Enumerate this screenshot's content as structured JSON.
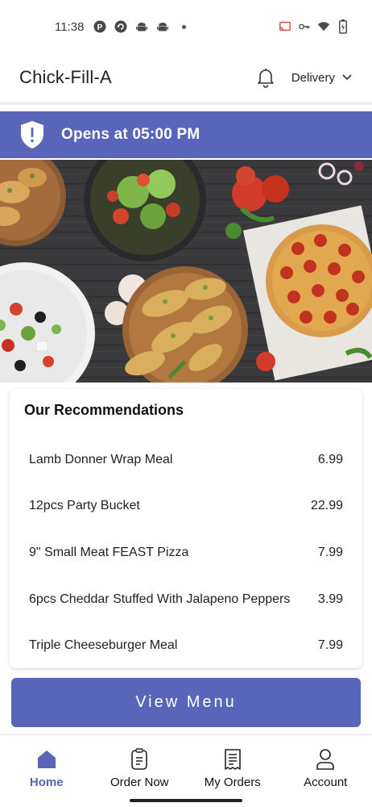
{
  "status_bar": {
    "time": "11:38",
    "left_icons": [
      "p-circle-icon",
      "refresh-circle-icon",
      "android-icon",
      "android-icon",
      "dot-icon"
    ],
    "right_icons": [
      "cast-icon",
      "key-icon",
      "wifi-icon",
      "battery-icon"
    ]
  },
  "header": {
    "title": "Chick-Fill-A",
    "bell_icon": "bell-icon",
    "mode_label": "Delivery"
  },
  "banner": {
    "icon": "shield-alert-icon",
    "text": "Opens at 05:00 PM",
    "color": "#5865b8"
  },
  "hero": {
    "icon": "food-hero-image"
  },
  "recommendations": {
    "title": "Our Recommendations",
    "items": [
      {
        "name": "Lamb Donner Wrap Meal",
        "price": "6.99"
      },
      {
        "name": "12pcs Party Bucket",
        "price": "22.99"
      },
      {
        "name": "9\" Small Meat FEAST Pizza",
        "price": "7.99"
      },
      {
        "name": "6pcs Cheddar Stuffed With Jalapeno Peppers",
        "price": "3.99"
      },
      {
        "name": "Triple Cheeseburger Meal",
        "price": "7.99"
      }
    ]
  },
  "view_menu": {
    "label": "View Menu",
    "color": "#5865b8"
  },
  "bottom_nav": {
    "items": [
      {
        "label": "Home",
        "icon": "home-icon",
        "active": true
      },
      {
        "label": "Order Now",
        "icon": "order-icon",
        "active": false
      },
      {
        "label": "My Orders",
        "icon": "receipt-icon",
        "active": false
      },
      {
        "label": "Account",
        "icon": "user-icon",
        "active": false
      }
    ],
    "active_color": "#5865b8"
  }
}
